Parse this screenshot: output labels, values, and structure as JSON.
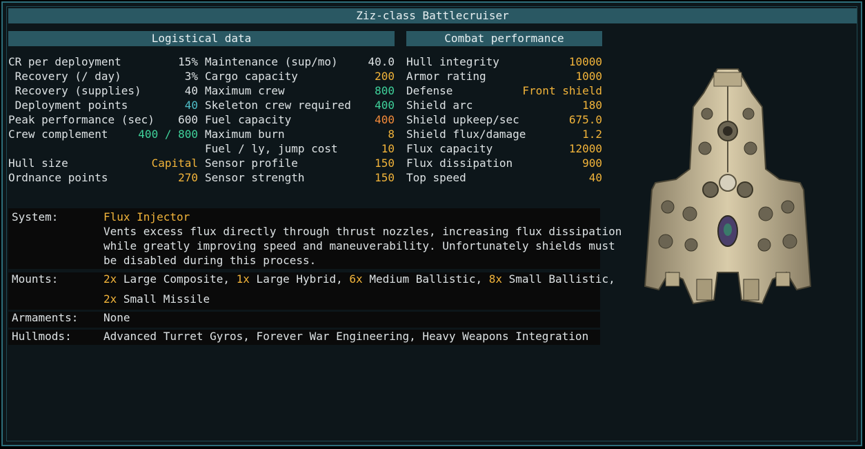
{
  "title": "Ziz-class Battlecruiser",
  "logistical": {
    "header": "Logistical data",
    "col1": [
      {
        "label": "CR per deployment",
        "value": "15%",
        "color": "w"
      },
      {
        "label": " Recovery (/ day)",
        "value": "3%",
        "color": "w"
      },
      {
        "label": " Recovery (supplies)",
        "value": "40",
        "color": "w"
      },
      {
        "label": " Deployment points",
        "value": "40",
        "color": "b"
      },
      {
        "label": "Peak performance (sec)",
        "value": "600",
        "color": "w"
      },
      {
        "label": "Crew complement",
        "value": "400 / 800",
        "color": "g"
      },
      {
        "label": "",
        "value": "",
        "color": "w"
      },
      {
        "label": "Hull size",
        "value": "Capital",
        "color": "y"
      },
      {
        "label": "Ordnance points",
        "value": "270",
        "color": "y"
      }
    ],
    "col2": [
      {
        "label": "Maintenance (sup/mo)",
        "value": "40.0",
        "color": "w"
      },
      {
        "label": "Cargo capacity",
        "value": "200",
        "color": "y"
      },
      {
        "label": "Maximum crew",
        "value": "800",
        "color": "g"
      },
      {
        "label": "Skeleton crew required",
        "value": "400",
        "color": "g"
      },
      {
        "label": "Fuel capacity",
        "value": "400",
        "color": "o"
      },
      {
        "label": "Maximum burn",
        "value": "8",
        "color": "y"
      },
      {
        "label": "Fuel / ly, jump cost",
        "value": "10",
        "color": "y"
      },
      {
        "label": "Sensor profile",
        "value": "150",
        "color": "y"
      },
      {
        "label": "Sensor strength",
        "value": "150",
        "color": "y"
      }
    ]
  },
  "combat": {
    "header": "Combat performance",
    "rows": [
      {
        "label": "Hull integrity",
        "value": "10000",
        "color": "y"
      },
      {
        "label": "Armor rating",
        "value": "1000",
        "color": "y"
      },
      {
        "label": "Defense",
        "value": "Front shield",
        "color": "y"
      },
      {
        "label": "Shield arc",
        "value": "180",
        "color": "y"
      },
      {
        "label": "Shield upkeep/sec",
        "value": "675.0",
        "color": "y"
      },
      {
        "label": "Shield flux/damage",
        "value": "1.2",
        "color": "y"
      },
      {
        "label": "Flux capacity",
        "value": "12000",
        "color": "y"
      },
      {
        "label": "Flux dissipation",
        "value": "900",
        "color": "y"
      },
      {
        "label": "Top speed",
        "value": "40",
        "color": "y"
      }
    ]
  },
  "system": {
    "label": "System:",
    "name": "Flux Injector",
    "desc": [
      "Vents excess flux directly through thrust nozzles, increasing flux dissipation",
      "while greatly improving speed and maneuverability. Unfortunately shields must",
      "be disabled during this process."
    ]
  },
  "mounts": {
    "label": "Mounts:",
    "line1": [
      {
        "n": "2x",
        "t": " Large Composite, "
      },
      {
        "n": "1x",
        "t": " Large Hybrid, "
      },
      {
        "n": "6x",
        "t": " Medium Ballistic, "
      },
      {
        "n": "8x",
        "t": " Small Ballistic,"
      }
    ],
    "line2": [
      {
        "n": "2x",
        "t": " Small Missile"
      }
    ]
  },
  "armaments": {
    "label": "Armaments:",
    "value": "None"
  },
  "hullmods": {
    "label": "Hullmods:",
    "value": "Advanced Turret Gyros, Forever War Engineering, Heavy Weapons Integration"
  },
  "colors": {
    "yellow": "#f2b43a",
    "green": "#3fd29b",
    "cyan": "#4fbec8",
    "orange": "#f58b3a",
    "panel_header": "#2a5863",
    "border": "#2e6f7c"
  },
  "ship_icon": "ziz-battlecruiser-sprite"
}
